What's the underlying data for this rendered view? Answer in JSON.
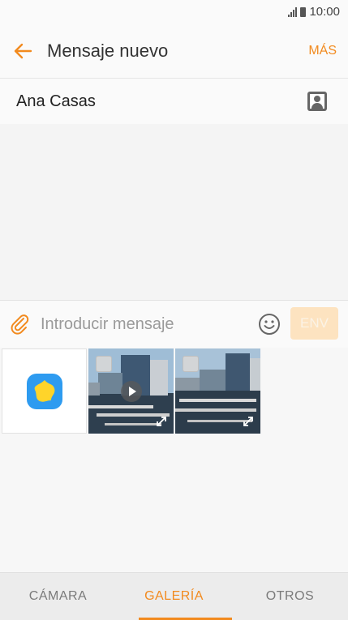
{
  "status_bar": {
    "time": "10:00",
    "signal_icon": "signal-icon",
    "battery_icon": "battery-icon"
  },
  "app_bar": {
    "back_icon": "arrow-left-icon",
    "title": "Mensaje nuevo",
    "more_label": "MÁS"
  },
  "recipient": {
    "name": "Ana Casas",
    "contact_icon": "contact-icon"
  },
  "composer": {
    "attach_icon": "paperclip-icon",
    "placeholder": "Introducir mensaje",
    "value": "",
    "emoji_icon": "smiley-icon",
    "send_label": "ENV"
  },
  "gallery": {
    "app_icon": "gallery-app-icon",
    "items": [
      {
        "type": "video",
        "icons": [
          "checkbox-icon",
          "play-icon",
          "expand-icon"
        ]
      },
      {
        "type": "photo",
        "icons": [
          "checkbox-icon",
          "expand-icon"
        ]
      }
    ]
  },
  "tabs": [
    {
      "label": "CÁMARA",
      "active": false
    },
    {
      "label": "GALERÍA",
      "active": true
    },
    {
      "label": "OTROS",
      "active": false
    }
  ],
  "colors": {
    "accent": "#f28a1e",
    "send_disabled_bg": "#fde3c0",
    "background": "#f7f7f7"
  }
}
